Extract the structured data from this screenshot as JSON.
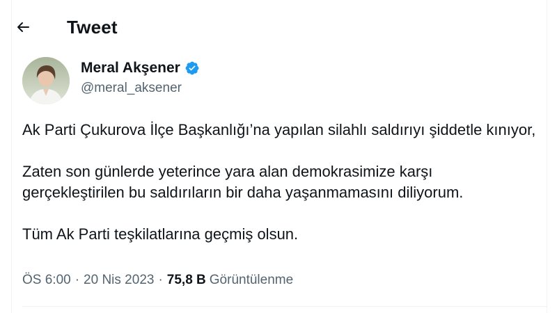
{
  "header": {
    "title": "Tweet",
    "back_icon": "arrow-left-icon"
  },
  "author": {
    "name": "Meral Akşener",
    "handle": "@meral_aksener",
    "verified_icon": "verified-badge-icon",
    "verified_color": "#1d9bf0"
  },
  "tweet": {
    "paragraphs": [
      "Ak Parti Çukurova İlçe Başkanlığı’na yapılan silahlı saldırıyı şiddetle kınıyor,",
      "Zaten son günlerde yeterince yara alan demokrasimize karşı gerçekleştirilen bu saldırıların bir daha yaşanmamasını diliyorum.",
      "Tüm Ak Parti teşkilatlarına geçmiş olsun."
    ]
  },
  "meta": {
    "time": "ÖS 6:00",
    "separator": "·",
    "date": "20 Nis 2023",
    "views_count": "75,8 B",
    "views_label": "Görüntülenme"
  },
  "colors": {
    "text_primary": "#0f1419",
    "text_secondary": "#536471",
    "border": "#eff3f4"
  }
}
